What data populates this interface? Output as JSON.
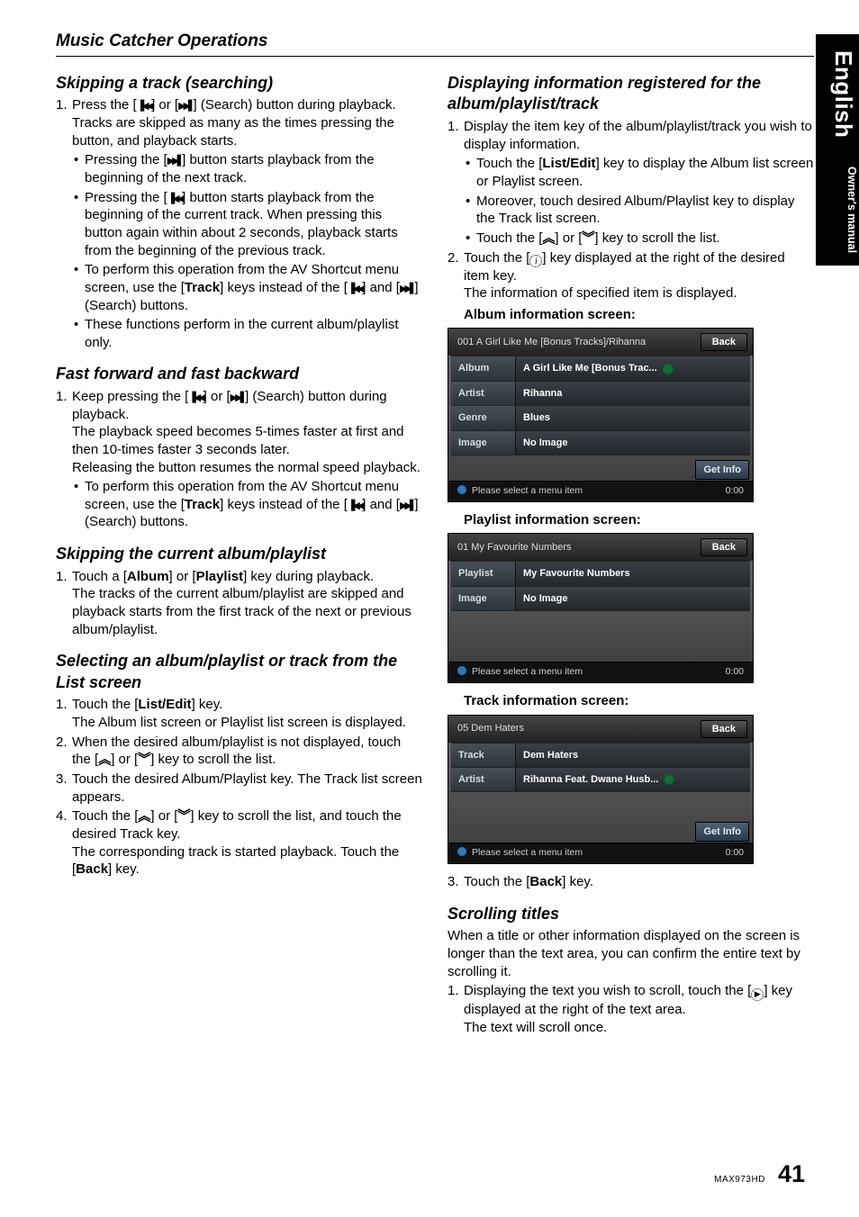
{
  "page": {
    "section_title": "Music Catcher Operations",
    "model": "MAX973HD",
    "page_number": "41"
  },
  "sidebar": {
    "lang": "English",
    "manual": "Owner's manual"
  },
  "left": {
    "h1": "Skipping a track (searching)",
    "s1_num": "1.",
    "s1_p1a": "Press the [",
    "s1_p1b": "] or [",
    "s1_p1c": "] (Search) button during playback.",
    "s1_p2": "Tracks are skipped as many as the times pressing the button, and playback starts.",
    "s1_b1a": "Pressing the [",
    "s1_b1b": "] button starts playback from the beginning of the next track.",
    "s1_b2a": "Pressing the [",
    "s1_b2b": "] button starts playback from the beginning of the current track. When pressing this button again within about 2 seconds, playback starts from the beginning of the previous track.",
    "s1_b3a": "To perform this operation from the AV Shortcut menu screen, use the [",
    "s1_b3_bold": "Track",
    "s1_b3b": "] keys instead of the [",
    "s1_b3c": "] and [",
    "s1_b3d": "] (Search) buttons.",
    "s1_b4": "These functions perform in the current album/playlist only.",
    "h2": "Fast forward and fast backward",
    "s2_num": "1.",
    "s2_p1a": "Keep pressing the [",
    "s2_p1b": "] or [",
    "s2_p1c": "] (Search) button during playback.",
    "s2_p2": "The playback speed becomes 5-times faster at first and then 10-times faster 3 seconds later.",
    "s2_p3": "Releasing the button resumes the normal speed playback.",
    "s2_b1a": "To perform this operation from the AV Shortcut menu screen, use the [",
    "s2_b1_bold": "Track",
    "s2_b1b": "] keys instead of the [",
    "s2_b1c": "] and [",
    "s2_b1d": "] (Search) buttons.",
    "h3": "Skipping the current album/playlist",
    "s3_num": "1.",
    "s3_p1a": "Touch a [",
    "s3_bold1": "Album",
    "s3_p1b": "] or [",
    "s3_bold2": "Playlist",
    "s3_p1c": "] key during playback.",
    "s3_p2": "The tracks of the current album/playlist are skipped and playback starts from the first track of the next or previous album/playlist.",
    "h4": "Selecting an album/playlist or track from the List screen",
    "s4_n1": "1.",
    "s4_p1a": "Touch the [",
    "s4_bold1": "List/Edit",
    "s4_p1b": "] key.",
    "s4_p1c": "The Album list screen or Playlist list screen is displayed.",
    "s4_n2": "2.",
    "s4_p2a": "When the desired album/playlist is not displayed, touch the [",
    "s4_p2b": "] or [",
    "s4_p2c": "] key to scroll the list.",
    "s4_n3": "3.",
    "s4_p3": "Touch the desired Album/Playlist key. The Track list screen appears.",
    "s4_n4": "4.",
    "s4_p4a": "Touch the [",
    "s4_p4b": "] or [",
    "s4_p4c": "] key to scroll the list, and touch the desired Track key.",
    "s4_p4d": "The corresponding track is started playback. Touch the [",
    "s4_bold_back": "Back",
    "s4_p4e": "] key."
  },
  "right": {
    "h1": "Displaying information registered for the album/playlist/track",
    "r1_n1": "1.",
    "r1_p1": "Display the item key of the album/playlist/track you wish to display information.",
    "r1_b1a": "Touch the [",
    "r1_bold_list": "List/Edit",
    "r1_b1b": "] key to display the Album list screen or Playlist screen.",
    "r1_b2": "Moreover, touch desired Album/Playlist key to display the Track list screen.",
    "r1_b3a": "Touch the [",
    "r1_b3b": "] or [",
    "r1_b3c": "] key to scroll the list.",
    "r1_n2": "2.",
    "r1_p2a": "Touch the [",
    "r1_p2b": "] key displayed at the right of the desired item key.",
    "r1_p2c": "The information of specified item is displayed.",
    "r1_album_head": "Album information screen:",
    "r1_playlist_head": "Playlist information screen:",
    "r1_track_head": "Track information screen:",
    "r1_n3": "3.",
    "r1_p3a": "Touch the [",
    "r1_bold_back": "Back",
    "r1_p3b": "] key.",
    "h2": "Scrolling titles",
    "r2_p1": "When a title or other information displayed on the screen is longer than the text area, you can confirm the entire text by scrolling it.",
    "r2_n1": "1.",
    "r2_p2a": "Displaying the text you wish to scroll, touch the [",
    "r2_p2b": "] key displayed at the right of the text area.",
    "r2_p2c": "The text will scroll once."
  },
  "screens": {
    "back_label": "Back",
    "getinfo_label": "Get Info",
    "status": "Please select a menu item",
    "time": "0:00",
    "album": {
      "title": "001 A Girl Like Me [Bonus Tracks]/Rihanna",
      "rows": [
        {
          "label": "Album",
          "value": "A Girl Like Me [Bonus Trac...",
          "scroll": true
        },
        {
          "label": "Artist",
          "value": "Rihanna"
        },
        {
          "label": "Genre",
          "value": "Blues"
        },
        {
          "label": "Image",
          "value": "No Image"
        }
      ]
    },
    "playlist": {
      "title": "01 My Favourite Numbers",
      "rows": [
        {
          "label": "Playlist",
          "value": "My Favourite Numbers"
        },
        {
          "label": "Image",
          "value": "No Image"
        }
      ]
    },
    "track": {
      "title": "05 Dem Haters",
      "rows": [
        {
          "label": "Track",
          "value": "Dem Haters"
        },
        {
          "label": "Artist",
          "value": "Rihanna Feat. Dwane Husb...",
          "scroll": true
        }
      ]
    }
  }
}
